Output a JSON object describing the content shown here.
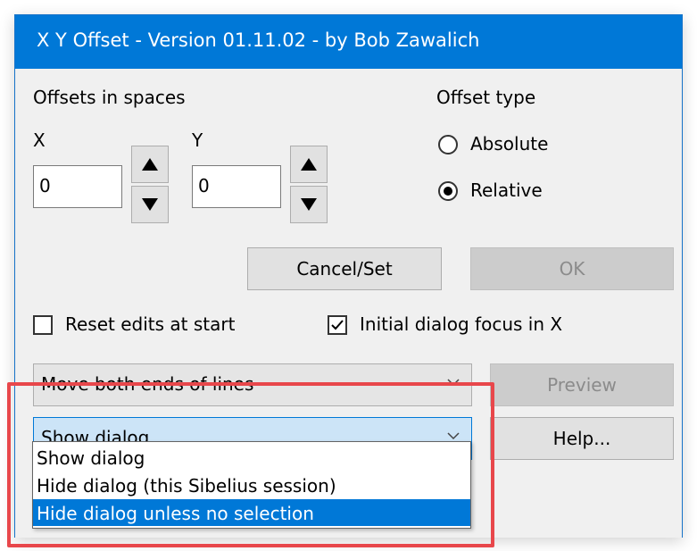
{
  "window": {
    "title": "X Y Offset - Version 01.11.02 - by Bob Zawalich"
  },
  "offsets": {
    "section_label": "Offsets in spaces",
    "x_label": "X",
    "y_label": "Y",
    "x_value": "0",
    "y_value": "0"
  },
  "offset_type": {
    "label": "Offset type",
    "options": [
      "Absolute",
      "Relative"
    ],
    "selected": "Relative"
  },
  "buttons": {
    "cancel_set": "Cancel/Set",
    "ok": "OK",
    "preview": "Preview",
    "help": "Help..."
  },
  "checkboxes": {
    "reset_edits": {
      "label": "Reset edits at start",
      "checked": false
    },
    "initial_focus": {
      "label": "Initial dialog focus in X",
      "checked": true
    }
  },
  "line_mode": {
    "value": "Move both ends of lines"
  },
  "dialog_mode": {
    "value": "Show dialog",
    "options": [
      "Show dialog",
      "Hide dialog (this Sibelius session)",
      "Hide dialog unless no selection"
    ],
    "highlighted": "Hide dialog unless no selection"
  },
  "colors": {
    "titlebar": "#0078d7",
    "highlight_border": "#e8474b",
    "selection": "#0078d7"
  }
}
